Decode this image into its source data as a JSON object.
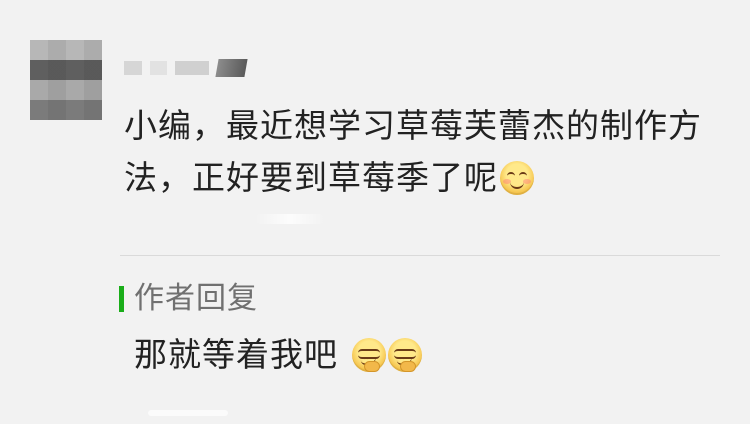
{
  "comment": {
    "line1": "小编，最近想学习草莓芙蕾杰的制作方",
    "line2": "法，正好要到草莓季了呢"
  },
  "reply": {
    "title": "作者回复",
    "text": "那就等着我吧"
  },
  "icons": {
    "comment_emoji": "smiling-blush-face-icon",
    "reply_emojis": [
      "smirk-hand-chin-face-icon",
      "smirk-hand-chin-face-icon"
    ]
  },
  "colors": {
    "reply_accent": "#1aad19",
    "text": "#222222",
    "muted": "#707070",
    "background": "#f2f2f2"
  }
}
